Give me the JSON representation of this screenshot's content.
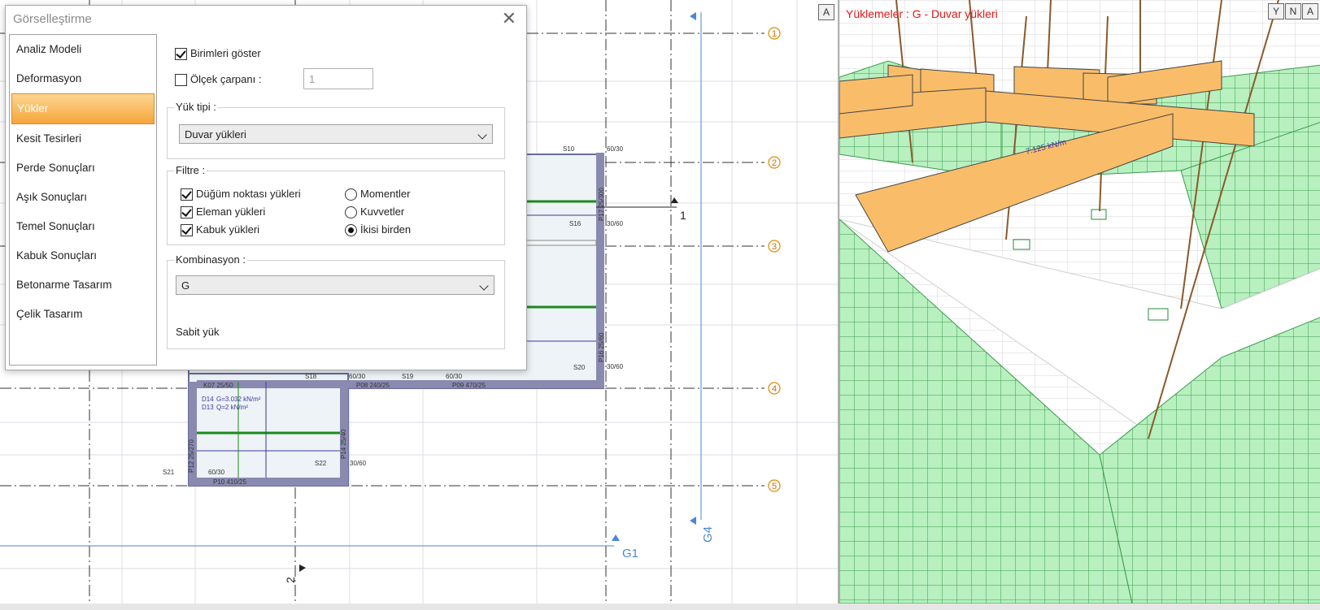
{
  "dialog": {
    "title": "Görselleştirme",
    "close": "✕",
    "nav": [
      "Analiz Modeli",
      "Deformasyon",
      "Yükler",
      "Kesit Tesirleri",
      "Perde Sonuçları",
      "Aşık Sonuçları",
      "Temel Sonuçları",
      "Kabuk Sonuçları",
      "Betonarme Tasarım",
      "Çelik Tasarım"
    ],
    "active_nav": "Yükler",
    "show_units_label": "Birimleri göster",
    "show_units_checked": true,
    "scale_label": "Ölçek çarpanı :",
    "scale_checked": false,
    "scale_value": "1",
    "load_type_title": "Yük tipi :",
    "load_type_value": "Duvar yükleri",
    "filter_title": "Filtre :",
    "filters": {
      "node": {
        "label": "Düğüm noktası yükleri",
        "checked": true
      },
      "element": {
        "label": "Eleman yükleri",
        "checked": true
      },
      "shell": {
        "label": "Kabuk yükleri",
        "checked": true
      }
    },
    "radios": {
      "moments": {
        "label": "Momentler",
        "selected": false
      },
      "forces": {
        "label": "Kuvvetler",
        "selected": false
      },
      "both": {
        "label": "İkisi birden",
        "selected": true
      }
    },
    "combination_title": "Kombinasyon :",
    "combination_value": "G",
    "fixed_load": "Sabit yük"
  },
  "view3d": {
    "title": "Yüklemeler : G - Duvar yükleri",
    "buttons": [
      "Y",
      "N",
      "A"
    ]
  },
  "plan": {
    "axis_labels": [
      "1",
      "2",
      "3",
      "4",
      "5"
    ],
    "grid_labels": [
      "G1",
      "G4"
    ],
    "section_labels": [
      "1",
      "2"
    ],
    "plan_button": "A",
    "texts": {
      "s10": "S10",
      "s16": "S16",
      "s18": "S18",
      "s19": "S19",
      "s20": "S20",
      "s21": "S21",
      "s22": "S22",
      "p14": "P14  25/40",
      "p16": "P16  25/60",
      "p17": "P17  25/300",
      "p12": "P12  25/270",
      "k07": "K07  25/50",
      "p08": "P08  240/25",
      "p09": "P09  470/25",
      "p10": "P10  410/25",
      "d60_1": "60/30",
      "d60_2": "30/60",
      "d60_3": "60/30",
      "d60_4": "60/30",
      "d60_5": "30/60",
      "d60_6": "30/60",
      "d60_7": "60/30",
      "load1": "G=3.032 kN/m²",
      "load2": "Q=2 kN/m²",
      "d14": "D14",
      "d13": "D13",
      "wall_load": "7.125 kN/m"
    }
  },
  "colors": {
    "accent": "#f6a53b",
    "grid_blue": "#4a86d8",
    "axis_orange": "#e08a00",
    "wall_orange": "#f9bd6a",
    "shell_green": "#b8f0c0",
    "load_red": "#e01a1a"
  }
}
